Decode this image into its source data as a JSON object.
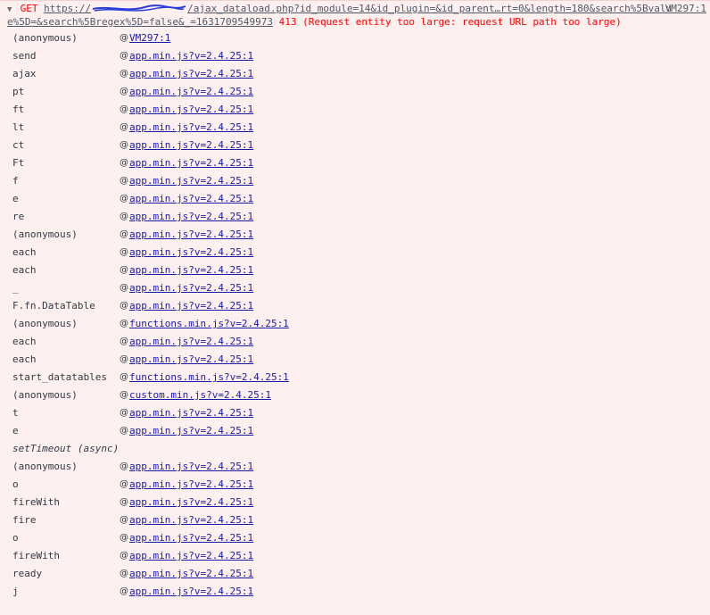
{
  "request": {
    "arrow": "▼",
    "method": "GET",
    "url_prefix": "https://",
    "url_suffix": "/ajax_dataload.php?id_module=14&id_plugin=&id_parent…rt=0&length=180&search%5Bvalu",
    "url_line2": "e%5D=&search%5Bregex%5D=false&_=1631709549973",
    "status": "413 (Request entity too large: request URL path too large)",
    "source": "VM297:1"
  },
  "at_symbol": "@",
  "stack": [
    {
      "fn": "(anonymous)",
      "loc": "VM297:1"
    },
    {
      "fn": "send",
      "loc": "app.min.js?v=2.4.25:1"
    },
    {
      "fn": "ajax",
      "loc": "app.min.js?v=2.4.25:1"
    },
    {
      "fn": "pt",
      "loc": "app.min.js?v=2.4.25:1"
    },
    {
      "fn": "ft",
      "loc": "app.min.js?v=2.4.25:1"
    },
    {
      "fn": "lt",
      "loc": "app.min.js?v=2.4.25:1"
    },
    {
      "fn": "ct",
      "loc": "app.min.js?v=2.4.25:1"
    },
    {
      "fn": "Ft",
      "loc": "app.min.js?v=2.4.25:1"
    },
    {
      "fn": "f",
      "loc": "app.min.js?v=2.4.25:1"
    },
    {
      "fn": "e",
      "loc": "app.min.js?v=2.4.25:1"
    },
    {
      "fn": "re",
      "loc": "app.min.js?v=2.4.25:1"
    },
    {
      "fn": "(anonymous)",
      "loc": "app.min.js?v=2.4.25:1"
    },
    {
      "fn": "each",
      "loc": "app.min.js?v=2.4.25:1"
    },
    {
      "fn": "each",
      "loc": "app.min.js?v=2.4.25:1"
    },
    {
      "fn": "_",
      "loc": "app.min.js?v=2.4.25:1"
    },
    {
      "fn": "F.fn.DataTable",
      "loc": "app.min.js?v=2.4.25:1"
    },
    {
      "fn": "(anonymous)",
      "loc": "functions.min.js?v=2.4.25:1"
    },
    {
      "fn": "each",
      "loc": "app.min.js?v=2.4.25:1"
    },
    {
      "fn": "each",
      "loc": "app.min.js?v=2.4.25:1"
    },
    {
      "fn": "start_datatables",
      "loc": "functions.min.js?v=2.4.25:1"
    },
    {
      "fn": "(anonymous)",
      "loc": "custom.min.js?v=2.4.25:1"
    },
    {
      "fn": "t",
      "loc": "app.min.js?v=2.4.25:1"
    },
    {
      "fn": "e",
      "loc": "app.min.js?v=2.4.25:1"
    },
    {
      "fn": "setTimeout (async)",
      "loc": "",
      "async": true
    },
    {
      "fn": "(anonymous)",
      "loc": "app.min.js?v=2.4.25:1"
    },
    {
      "fn": "o",
      "loc": "app.min.js?v=2.4.25:1"
    },
    {
      "fn": "fireWith",
      "loc": "app.min.js?v=2.4.25:1"
    },
    {
      "fn": "fire",
      "loc": "app.min.js?v=2.4.25:1"
    },
    {
      "fn": "o",
      "loc": "app.min.js?v=2.4.25:1"
    },
    {
      "fn": "fireWith",
      "loc": "app.min.js?v=2.4.25:1"
    },
    {
      "fn": "ready",
      "loc": "app.min.js?v=2.4.25:1"
    },
    {
      "fn": "j",
      "loc": "app.min.js?v=2.4.25:1"
    }
  ],
  "colors": {
    "error_bg": "#fff0f0",
    "error_text": "#ff0000",
    "link": "#1a1aa6"
  }
}
